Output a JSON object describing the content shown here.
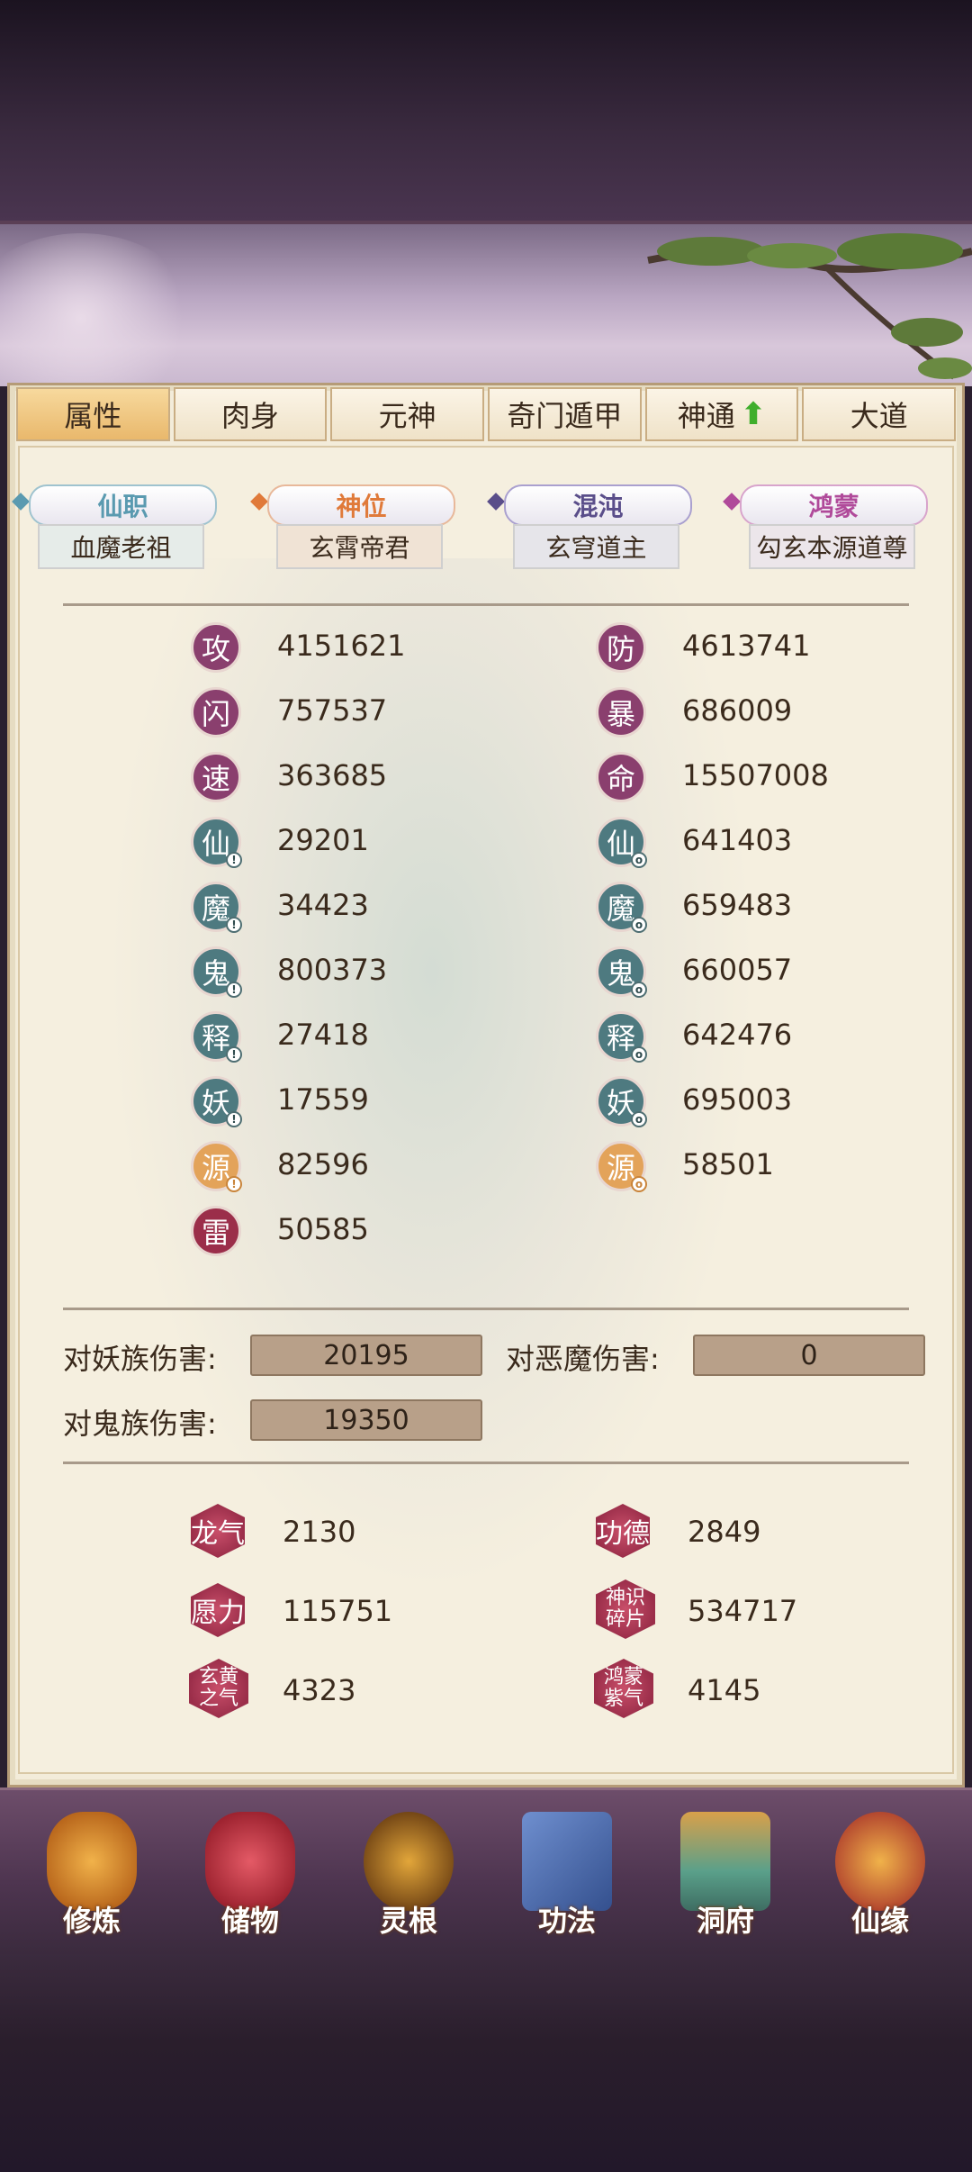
{
  "tabs": [
    {
      "label": "属性",
      "active": true
    },
    {
      "label": "肉身",
      "active": false
    },
    {
      "label": "元神",
      "active": false
    },
    {
      "label": "奇门遁甲",
      "active": false
    },
    {
      "label": "神通",
      "active": false,
      "icon": "green-up-arrow-icon"
    },
    {
      "label": "大道",
      "active": false
    }
  ],
  "ranks": [
    {
      "title": "仙职",
      "value": "血魔老祖",
      "color": "#5a9ab0"
    },
    {
      "title": "神位",
      "value": "玄霄帝君",
      "color": "#e07a3a"
    },
    {
      "title": "混沌",
      "value": "玄穹道主",
      "color": "#5a4e8a"
    },
    {
      "title": "鸿蒙",
      "value": "勾玄本源道尊",
      "color": "#b04a9a"
    }
  ],
  "stats_left": [
    {
      "icon": "攻",
      "value": "4151621",
      "color": "#8a3f6e"
    },
    {
      "icon": "闪",
      "value": "757537",
      "color": "#8a3f6e"
    },
    {
      "icon": "速",
      "value": "363685",
      "color": "#8a3f6e"
    },
    {
      "icon": "仙",
      "value": "29201",
      "color": "#4e7a80",
      "sub": "!"
    },
    {
      "icon": "魔",
      "value": "34423",
      "color": "#4e7a80",
      "sub": "!"
    },
    {
      "icon": "鬼",
      "value": "800373",
      "color": "#4e7a80",
      "sub": "!"
    },
    {
      "icon": "释",
      "value": "27418",
      "color": "#4e7a80",
      "sub": "!"
    },
    {
      "icon": "妖",
      "value": "17559",
      "color": "#4e7a80",
      "sub": "!"
    },
    {
      "icon": "源",
      "value": "82596",
      "color": "#e3a35a",
      "sub": "!"
    },
    {
      "icon": "雷",
      "value": "50585",
      "color": "#9b2e4a"
    }
  ],
  "stats_right": [
    {
      "icon": "防",
      "value": "4613741",
      "color": "#8a3f6e"
    },
    {
      "icon": "暴",
      "value": "686009",
      "color": "#8a3f6e"
    },
    {
      "icon": "命",
      "value": "15507008",
      "color": "#8a3f6e"
    },
    {
      "icon": "仙",
      "value": "641403",
      "color": "#4e7a80",
      "sub": "o"
    },
    {
      "icon": "魔",
      "value": "659483",
      "color": "#4e7a80",
      "sub": "o"
    },
    {
      "icon": "鬼",
      "value": "660057",
      "color": "#4e7a80",
      "sub": "o"
    },
    {
      "icon": "释",
      "value": "642476",
      "color": "#4e7a80",
      "sub": "o"
    },
    {
      "icon": "妖",
      "value": "695003",
      "color": "#4e7a80",
      "sub": "o"
    },
    {
      "icon": "源",
      "value": "58501",
      "color": "#e3a35a",
      "sub": "o"
    }
  ],
  "damage": {
    "yao_label": "对妖族伤害:",
    "yao_value": "20195",
    "emo_label": "对恶魔伤害:",
    "emo_value": "0",
    "gui_label": "对鬼族伤害:",
    "gui_value": "19350"
  },
  "misc": [
    {
      "icon": "龙气",
      "value": "2130"
    },
    {
      "icon": "功德",
      "value": "2849"
    },
    {
      "icon": "愿力",
      "value": "115751"
    },
    {
      "icon": "神识碎片",
      "value": "534717"
    },
    {
      "icon": "玄黄之气",
      "value": "4323"
    },
    {
      "icon": "鸿蒙紫气",
      "value": "4145"
    }
  ],
  "nav": [
    {
      "label": "修炼",
      "icon": "monk-icon",
      "color": "#d88a2a"
    },
    {
      "label": "储物",
      "icon": "bag-icon",
      "color": "#c0394a"
    },
    {
      "label": "灵根",
      "icon": "spirit-root-icon",
      "color": "#b87a20"
    },
    {
      "label": "功法",
      "icon": "book-icon",
      "color": "#4a6aa8"
    },
    {
      "label": "洞府",
      "icon": "palace-icon",
      "color": "#5aa08a"
    },
    {
      "label": "仙缘",
      "icon": "gourd-icon",
      "color": "#c0583a"
    }
  ]
}
